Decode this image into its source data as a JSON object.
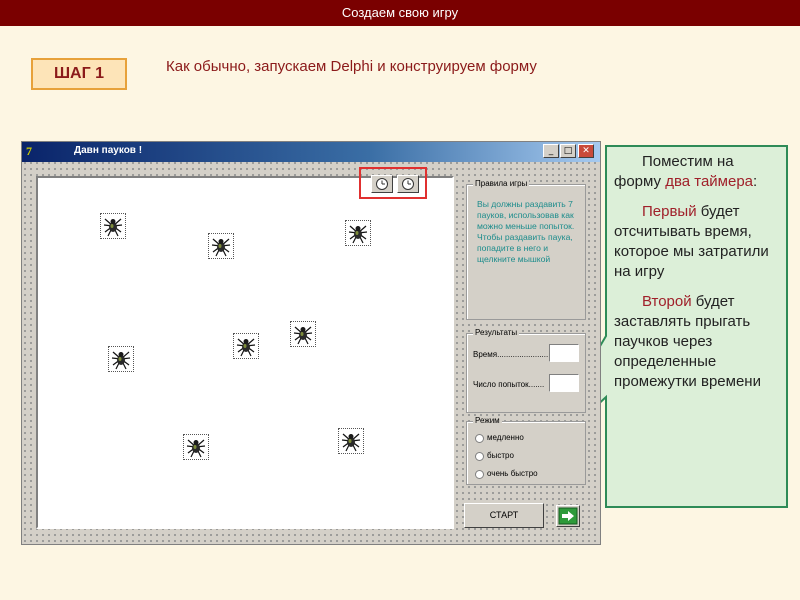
{
  "header": {
    "title": "Создаем свою игру"
  },
  "step": {
    "label": "ШАГ 1"
  },
  "heading": "Как обычно, запускаем Delphi и конструируем форму",
  "window": {
    "title": "Давн пауков !",
    "buttons": {
      "minimize": "_",
      "maximize": "□",
      "close": "✕"
    }
  },
  "rules": {
    "title": "Правила игры",
    "text": "Вы должны раздавить 7 пауков, использовав как можно меньше попыток. Чтобы раздавить паука, попадите в него и щелкните мышкой"
  },
  "results": {
    "title": "Результаты",
    "time_label": "Время.......................",
    "attempts_label": "Число попыток.......",
    "time_value": "",
    "attempts_value": ""
  },
  "mode": {
    "title": "Режим",
    "options": [
      "медленно",
      "быстро",
      "очень быстро"
    ]
  },
  "start_button": "СТАРТ",
  "spider_count": 8,
  "callout": {
    "p1_a": "Поместим на форму ",
    "p1_b": "два таймера",
    "p1_c": ":",
    "p2_a": "Первый",
    "p2_b": " будет отсчитывать время, которое мы затратили на игру",
    "p3_a": "Второй",
    "p3_b": " будет заставлять прыгать паучков через определенные промежутки времени"
  },
  "colors": {
    "accent": "#7a0000",
    "callout_border": "#2e8b57",
    "callout_bg": "#dcefd8",
    "highlight": "#a0202a"
  }
}
